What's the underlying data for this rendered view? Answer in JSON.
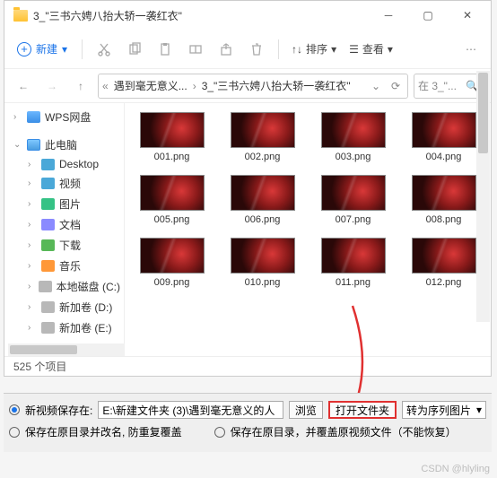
{
  "titlebar": {
    "title": "3_\"三书六娉八抬大轿一袭红衣\""
  },
  "toolbar": {
    "new_label": "新建",
    "sort_label": "排序",
    "view_label": "查看"
  },
  "breadcrumbs": {
    "ellipsis": "«",
    "seg1": "遇到毫无意义... ",
    "seg2": "3_\"三书六娉八抬大轿一袭红衣\""
  },
  "search": {
    "prefix": "在 3_\"...",
    "icon": "🔍"
  },
  "sidebar": {
    "items": [
      {
        "label": "WPS网盘",
        "caret": "›"
      },
      {
        "label": "此电脑",
        "caret": "⌄"
      },
      {
        "label": "Desktop",
        "caret": "›"
      },
      {
        "label": "视频",
        "caret": "›"
      },
      {
        "label": "图片",
        "caret": "›"
      },
      {
        "label": "文档",
        "caret": "›"
      },
      {
        "label": "下载",
        "caret": "›"
      },
      {
        "label": "音乐",
        "caret": "›"
      },
      {
        "label": "本地磁盘 (C:)",
        "caret": "›"
      },
      {
        "label": "新加卷 (D:)",
        "caret": "›"
      },
      {
        "label": "新加卷 (E:)",
        "caret": "›"
      }
    ]
  },
  "files": [
    {
      "name": "001.png"
    },
    {
      "name": "002.png"
    },
    {
      "name": "003.png"
    },
    {
      "name": "004.png"
    },
    {
      "name": "005.png"
    },
    {
      "name": "006.png"
    },
    {
      "name": "007.png"
    },
    {
      "name": "008.png"
    },
    {
      "name": "009.png"
    },
    {
      "name": "010.png"
    },
    {
      "name": "011.png"
    },
    {
      "name": "012.png"
    }
  ],
  "status": {
    "count": "525 个项目"
  },
  "bottom": {
    "opt_save_new": "新视频保存在:",
    "path": "E:\\新建文件夹 (3)\\遇到毫无意义的人",
    "browse": "浏览",
    "open_folder": "打开文件夹",
    "convert_label": "转为序列图片",
    "opt_save_orig_rename": "保存在原目录并改名, 防重复覆盖",
    "opt_save_orig_overwrite": "保存在原目录，并覆盖原视频文件（不能恢复）"
  },
  "watermark": "CSDN @hlyling"
}
